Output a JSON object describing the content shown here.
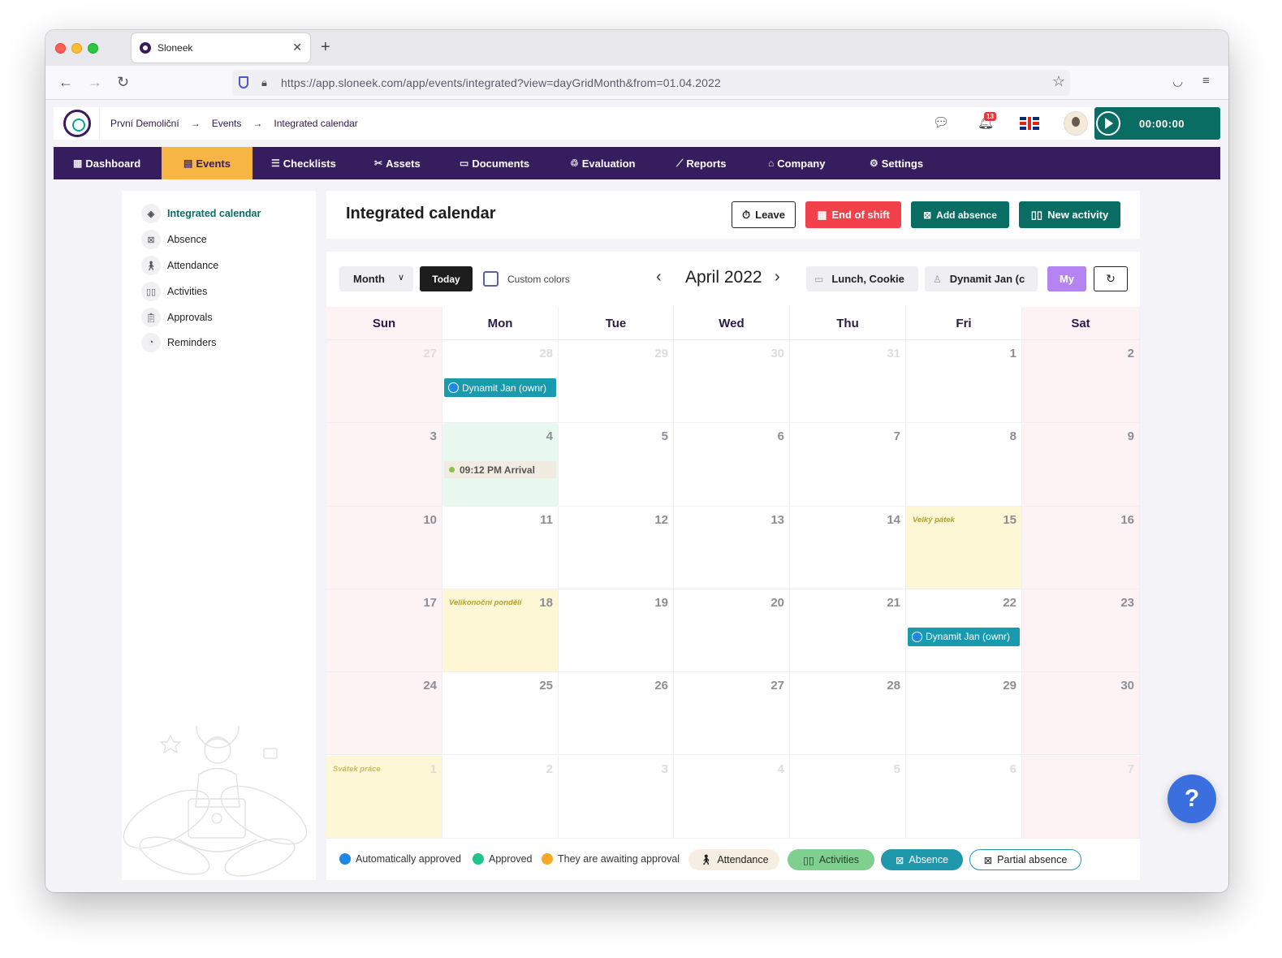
{
  "browser": {
    "tab_title": "Sloneek",
    "url": "https://app.sloneek.com/app/events/integrated?view=dayGridMonth&from=01.04.2022"
  },
  "header": {
    "breadcrumb": [
      "První Demoliční",
      "Events",
      "Integrated calendar"
    ],
    "notification_count": "13",
    "timer": "00:00:00"
  },
  "mainnav": [
    {
      "label": "Dashboard",
      "icon": "grid-icon"
    },
    {
      "label": "Events",
      "icon": "calendar-icon",
      "active": true
    },
    {
      "label": "Checklists",
      "icon": "checklist-icon"
    },
    {
      "label": "Assets",
      "icon": "tools-icon"
    },
    {
      "label": "Documents",
      "icon": "folder-icon"
    },
    {
      "label": "Evaluation",
      "icon": "evaluation-icon"
    },
    {
      "label": "Reports",
      "icon": "chart-icon"
    },
    {
      "label": "Company",
      "icon": "building-icon"
    },
    {
      "label": "Settings",
      "icon": "gear-icon"
    }
  ],
  "sidebar": {
    "items": [
      {
        "label": "Integrated calendar",
        "icon": "layers-icon",
        "active": true
      },
      {
        "label": "Absence",
        "icon": "calendar-x-icon"
      },
      {
        "label": "Attendance",
        "icon": "walking-icon"
      },
      {
        "label": "Activities",
        "icon": "book-icon"
      },
      {
        "label": "Approvals",
        "icon": "clipboard-icon"
      },
      {
        "label": "Reminders",
        "icon": "reminder-icon"
      }
    ]
  },
  "page": {
    "title": "Integrated calendar",
    "actions": {
      "leave": "Leave",
      "end_of_shift": "End of shift",
      "add_absence": "Add absence",
      "new_activity": "New activity"
    }
  },
  "calendar": {
    "view": "Month",
    "today_label": "Today",
    "custom_colors_label": "Custom colors",
    "month_title": "April 2022",
    "filter_place": "Lunch, Cookie",
    "filter_person": "Dynamit Jan (c",
    "my_label": "My",
    "weekdays": [
      "Sun",
      "Mon",
      "Tue",
      "Wed",
      "Thu",
      "Fri",
      "Sat"
    ],
    "weeks": [
      [
        {
          "d": "27",
          "o": true
        },
        {
          "d": "28",
          "o": true
        },
        {
          "d": "29",
          "o": true
        },
        {
          "d": "30",
          "o": true
        },
        {
          "d": "31",
          "o": true
        },
        {
          "d": "1"
        },
        {
          "d": "2"
        }
      ],
      [
        {
          "d": "3"
        },
        {
          "d": "4",
          "today": true
        },
        {
          "d": "5"
        },
        {
          "d": "6"
        },
        {
          "d": "7"
        },
        {
          "d": "8"
        },
        {
          "d": "9"
        }
      ],
      [
        {
          "d": "10"
        },
        {
          "d": "11"
        },
        {
          "d": "12"
        },
        {
          "d": "13"
        },
        {
          "d": "14"
        },
        {
          "d": "15",
          "holiday": "Velký pátek"
        },
        {
          "d": "16"
        }
      ],
      [
        {
          "d": "17"
        },
        {
          "d": "18",
          "holiday": "Velikonoční pondělí"
        },
        {
          "d": "19"
        },
        {
          "d": "20"
        },
        {
          "d": "21"
        },
        {
          "d": "22"
        },
        {
          "d": "23"
        }
      ],
      [
        {
          "d": "24"
        },
        {
          "d": "25"
        },
        {
          "d": "26"
        },
        {
          "d": "27"
        },
        {
          "d": "28"
        },
        {
          "d": "29"
        },
        {
          "d": "30"
        }
      ],
      [
        {
          "d": "1",
          "o": true,
          "holiday": "Svátek práce"
        },
        {
          "d": "2",
          "o": true
        },
        {
          "d": "3",
          "o": true
        },
        {
          "d": "4",
          "o": true
        },
        {
          "d": "5",
          "o": true
        },
        {
          "d": "6",
          "o": true
        },
        {
          "d": "7",
          "o": true
        }
      ]
    ],
    "events": [
      {
        "week": 0,
        "day": 1,
        "type": "absence",
        "label": "Dynamit Jan (ownr)"
      },
      {
        "week": 1,
        "day": 1,
        "type": "arrival",
        "label": "09:12 PM Arrival"
      },
      {
        "week": 3,
        "day": 5,
        "type": "absence",
        "label": "Dynamit Jan (ownr)"
      }
    ]
  },
  "legend": {
    "statuses": [
      {
        "label": "Automatically approved",
        "color": "#1e88e5"
      },
      {
        "label": "Approved",
        "color": "#1fc58c"
      },
      {
        "label": "They are awaiting approval",
        "color": "#f9a825"
      }
    ],
    "types": [
      {
        "label": "Attendance",
        "icon": "walking-icon"
      },
      {
        "label": "Activities",
        "icon": "book-icon"
      },
      {
        "label": "Absence",
        "icon": "calendar-x-icon"
      },
      {
        "label": "Partial absence",
        "icon": "calendar-x-icon"
      }
    ]
  },
  "help_label": "?"
}
